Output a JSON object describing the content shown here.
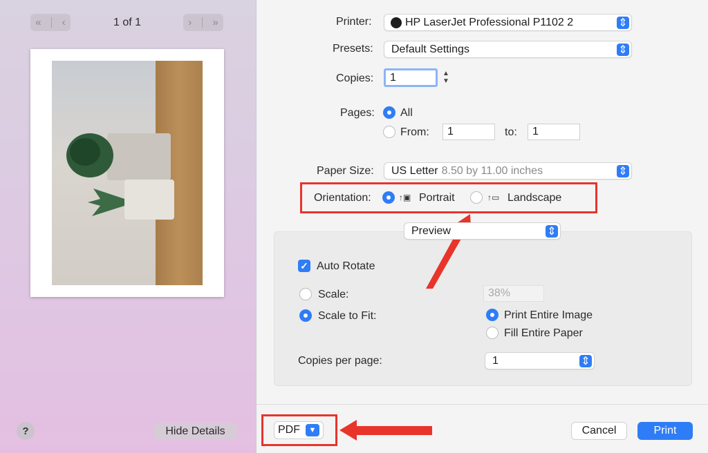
{
  "preview": {
    "page_count": "1 of 1",
    "hide_details_label": "Hide Details",
    "help_label": "?"
  },
  "printer": {
    "label": "Printer:",
    "value": "HP LaserJet Professional P1102 2"
  },
  "presets": {
    "label": "Presets:",
    "value": "Default Settings"
  },
  "copies": {
    "label": "Copies:",
    "value": "1"
  },
  "pages": {
    "label": "Pages:",
    "all_label": "All",
    "from_label": "From:",
    "from_value": "1",
    "to_label": "to:",
    "to_value": "1"
  },
  "paper_size": {
    "label": "Paper Size:",
    "value": "US Letter",
    "detail": "8.50 by 11.00 inches"
  },
  "orientation": {
    "label": "Orientation:",
    "portrait_label": "Portrait",
    "landscape_label": "Landscape"
  },
  "app_section": {
    "value": "Preview",
    "auto_rotate_label": "Auto Rotate",
    "scale_label": "Scale:",
    "scale_value": "38%",
    "scale_to_fit_label": "Scale to Fit:",
    "print_entire_image_label": "Print Entire Image",
    "fill_entire_paper_label": "Fill Entire Paper",
    "copies_per_page_label": "Copies per page:",
    "copies_per_page_value": "1"
  },
  "footer": {
    "pdf_label": "PDF",
    "cancel_label": "Cancel",
    "print_label": "Print"
  },
  "colors": {
    "accent": "#2f7df6",
    "annotation": "#e8342b"
  }
}
